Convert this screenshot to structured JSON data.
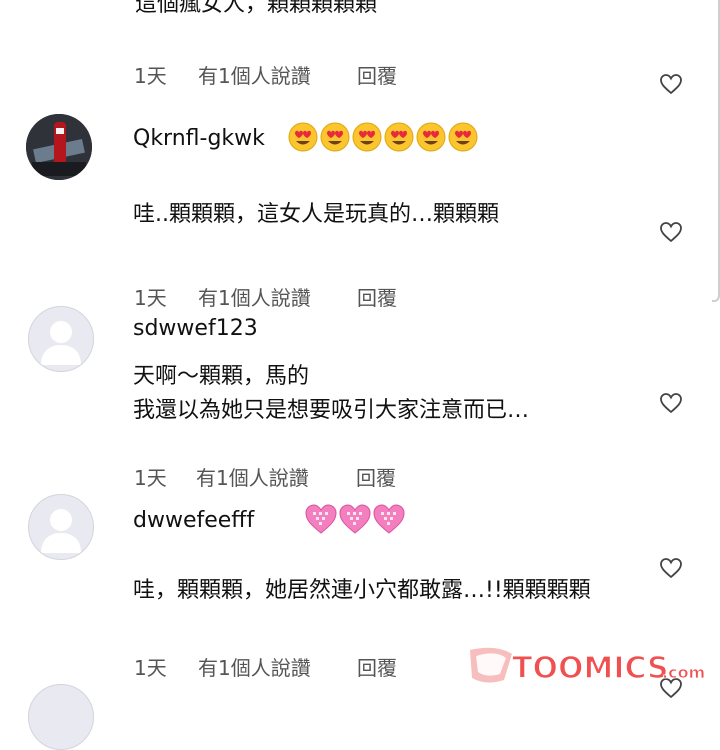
{
  "top_cut_comment": {
    "text": "這個瘋女人，顆顆顆顆顆"
  },
  "comments": [
    {
      "username": "",
      "meta": {
        "time": "1天",
        "likes": "有1個人說讚",
        "reply": "回覆"
      }
    },
    {
      "username": "Qkrnfl-gkwk",
      "emoji": [
        "heart-eyes",
        "heart-eyes",
        "heart-eyes",
        "heart-eyes",
        "heart-eyes",
        "heart-eyes"
      ],
      "text": "哇..顆顆顆，這女人是玩真的…顆顆顆",
      "meta": {
        "time": "1天",
        "likes": "有1個人說讚",
        "reply": "回覆"
      }
    },
    {
      "username": "sdwwef123",
      "text_line1": "天啊～顆顆，馬的",
      "text_line2": "我還以為她只是想要吸引大家注意而已…",
      "meta": {
        "time": "1天",
        "likes": "有1個人說讚",
        "reply": "回覆"
      }
    },
    {
      "username": "dwwefeefff",
      "emoji": [
        "pink-heart",
        "pink-heart",
        "pink-heart"
      ],
      "text": "哇，顆顆顆，她居然連小穴都敢露…!!顆顆顆顆",
      "meta": {
        "time": "1天",
        "likes": "有1個人說讚",
        "reply": "回覆"
      }
    }
  ],
  "watermark": {
    "logo": "TOOMICS.com"
  },
  "colors": {
    "heart_outline": "#444444",
    "meta_text": "#555555",
    "avatar_bg": "#e9eaf1",
    "avatar_figure": "#ffffff",
    "watermark_red": "#f0504f"
  }
}
